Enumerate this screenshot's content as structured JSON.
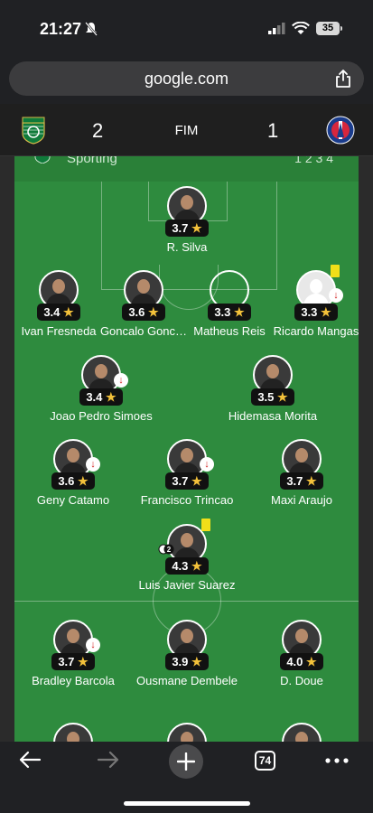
{
  "status_bar": {
    "time": "21:27",
    "battery": "35"
  },
  "browser": {
    "url": "google.com",
    "tabs_count": "74"
  },
  "match": {
    "home_score": "2",
    "status": "FIM",
    "away_score": "1",
    "home_team_header": "Sporting",
    "header_form": "1 2 3 4"
  },
  "players": [
    {
      "name": "R. Silva",
      "rating": "3.7",
      "avatar": "photo"
    },
    {
      "name": "Ivan Fresneda",
      "rating": "3.4",
      "avatar": "photo"
    },
    {
      "name": "Goncalo Gonc…",
      "rating": "3.6",
      "avatar": "photo"
    },
    {
      "name": "Matheus Reis",
      "rating": "3.3",
      "avatar": "empty"
    },
    {
      "name": "Ricardo Mangas",
      "rating": "3.3",
      "avatar": "generic"
    },
    {
      "name": "Joao Pedro Simoes",
      "rating": "3.4",
      "avatar": "photo"
    },
    {
      "name": "Hidemasa Morita",
      "rating": "3.5",
      "avatar": "photo"
    },
    {
      "name": "Geny Catamo",
      "rating": "3.6",
      "avatar": "photo"
    },
    {
      "name": "Francisco Trincao",
      "rating": "3.7",
      "avatar": "photo"
    },
    {
      "name": "Maxi Araujo",
      "rating": "3.7",
      "avatar": "photo"
    },
    {
      "name": "Luis Javier Suarez",
      "rating": "4.3",
      "avatar": "photo",
      "goals": "2"
    },
    {
      "name": "Bradley Barcola",
      "rating": "3.7",
      "avatar": "photo"
    },
    {
      "name": "Ousmane Dembele",
      "rating": "3.9",
      "avatar": "photo"
    },
    {
      "name": "D. Doue",
      "rating": "4.0",
      "avatar": "photo"
    }
  ],
  "icons": {
    "back": "arrow-left-icon",
    "forward": "arrow-right-icon",
    "new_tab": "plus-icon",
    "menu": "more-dots-icon"
  },
  "colors": {
    "pitch": "#2e8b3e",
    "rating_bg": "#111111",
    "star": "#f3c13a",
    "yellow_card": "#f1df19",
    "sub_arrow": "#d32020"
  }
}
